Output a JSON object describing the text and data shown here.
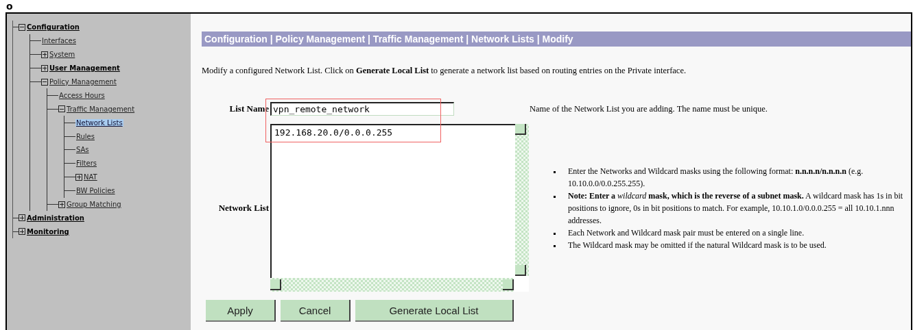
{
  "corner_mark": "o",
  "tree": [
    {
      "label": "Configuration",
      "bold": true,
      "expanded": true,
      "selected": false,
      "children": [
        {
          "label": "Interfaces",
          "selected": false
        },
        {
          "label": "System",
          "expanded": false,
          "selected": false
        },
        {
          "label": "User Management",
          "bold": true,
          "expanded": false,
          "selected": false
        },
        {
          "label": "Policy Management",
          "expanded": true,
          "selected": false,
          "children": [
            {
              "label": "Access Hours",
              "selected": false
            },
            {
              "label": "Traffic Management",
              "expanded": true,
              "selected": false,
              "children": [
                {
                  "label": "Network Lists",
                  "selected": true
                },
                {
                  "label": "Rules",
                  "selected": false
                },
                {
                  "label": "SAs",
                  "selected": false
                },
                {
                  "label": "Filters",
                  "selected": false
                },
                {
                  "label": "NAT",
                  "expanded": false,
                  "selected": false
                },
                {
                  "label": "BW Policies",
                  "selected": false
                }
              ]
            },
            {
              "label": "Group Matching",
              "expanded": false,
              "selected": false
            }
          ]
        }
      ]
    },
    {
      "label": "Administration",
      "bold": true,
      "expanded": false,
      "selected": false
    },
    {
      "label": "Monitoring",
      "bold": true,
      "expanded": false,
      "selected": false
    }
  ],
  "breadcrumb": "Configuration | Policy Management | Traffic Management | Network Lists | Modify",
  "intro": "Modify a configured Network List. Click on **Generate Local List** to generate a network list based on routing entries on the Private interface.",
  "list_name": {
    "label": "List Name",
    "value": "vpn_remote_network",
    "help": "Name of the Network List you are adding. The name must be unique."
  },
  "network_list": {
    "label": "Network List",
    "value": "192.168.20.0/0.0.0.255"
  },
  "help_bullets": [
    "Enter the Networks and Wildcard masks using the following format: **n.n.n.n/n.n.n.n** (e.g. 10.10.0.0/0.0.255.255).",
    "**Note: Enter a** *wildcard* **mask, which is the reverse of a subnet mask.** A wildcard mask has 1s in bit positions to ignore, 0s in bit positions to match. For example, 10.10.1.0/0.0.0.255 = all 10.10.1.nnn addresses.",
    "Each Network and Wildcard mask pair must be entered on a single line.",
    "The Wildcard mask may be omitted if the natural Wildcard mask is to be used."
  ],
  "buttons": [
    "Apply",
    "Cancel",
    "Generate Local List"
  ]
}
